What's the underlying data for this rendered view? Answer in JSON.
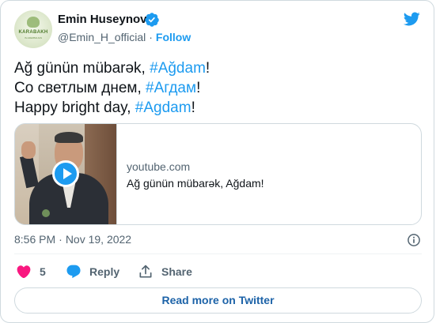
{
  "author": {
    "name": "Emin Huseynov",
    "handle": "@Emin_H_official",
    "separator": "·",
    "follow_label": "Follow",
    "avatar_text": "KARABAKH",
    "avatar_tagline": "IS AZERBAIJAN",
    "verified_icon": "verified-badge-icon"
  },
  "brand": {
    "logo_icon": "twitter-bird-icon",
    "accent_color": "#1d9bf0",
    "text_color": "#0f1419",
    "secondary_color": "#536471",
    "like_color": "#f91880"
  },
  "tweet": {
    "lines": [
      {
        "prefix": "Ağ günün mübarək, ",
        "hashtag": "#Ağdam",
        "suffix": "!"
      },
      {
        "prefix": "Со светлым днем, ",
        "hashtag": "#Агдам",
        "suffix": "!"
      },
      {
        "prefix": "Happy bright day, ",
        "hashtag": "#Agdam",
        "suffix": "!"
      }
    ]
  },
  "link_card": {
    "domain": "youtube.com",
    "title": "Ağ günün mübarək, Ağdam!",
    "play_icon": "play-icon"
  },
  "meta": {
    "time": "8:56 PM",
    "separator": "·",
    "date": "Nov 19, 2022",
    "info_icon": "info-icon"
  },
  "actions": {
    "like_count": "5",
    "reply_label": "Reply",
    "share_label": "Share"
  },
  "footer": {
    "read_more_label": "Read more on Twitter"
  }
}
